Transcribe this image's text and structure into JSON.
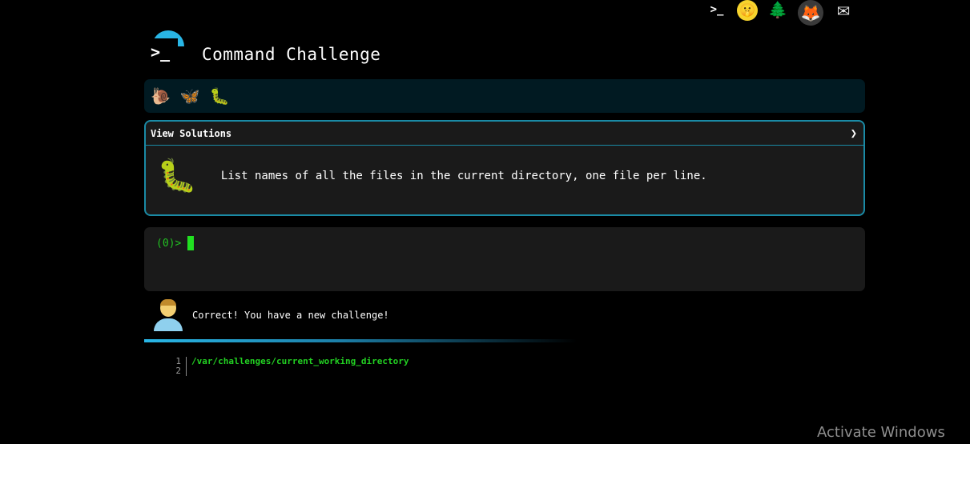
{
  "top_icons": [
    {
      "name": "terminal-icon",
      "glyph": ">_"
    },
    {
      "name": "shushing-face-icon",
      "glyph": "🤫"
    },
    {
      "name": "tree-icon",
      "glyph": "🌲"
    },
    {
      "name": "gitlab-icon",
      "glyph": "🦊"
    },
    {
      "name": "mail-icon",
      "glyph": "✉"
    }
  ],
  "header": {
    "title": "Command Challenge",
    "logo_glyph": ">_"
  },
  "bugs": [
    {
      "name": "snail-icon",
      "glyph": "🐌"
    },
    {
      "name": "butterfly-icon",
      "glyph": "🦋"
    },
    {
      "name": "caterpillar-icon",
      "glyph": "🐛"
    }
  ],
  "challenge": {
    "header_label": "View Solutions",
    "chevron": "❯",
    "bug_glyph": "🐛",
    "text": "List names of all the files in the current directory, one file per line."
  },
  "terminal": {
    "prompt": "(0)>"
  },
  "feedback": {
    "message": "Correct! You have a new challenge!"
  },
  "code": {
    "lines": [
      {
        "num": "1",
        "text": "/var/challenges/current_working_directory"
      },
      {
        "num": "2",
        "text": ""
      }
    ]
  },
  "watermark": "Activate Windows",
  "colors": {
    "accent": "#29b6e6",
    "card_border": "#1a8aa5",
    "prompt_green": "#22c222",
    "cursor_green": "#21e021",
    "code_green": "#22d022"
  }
}
